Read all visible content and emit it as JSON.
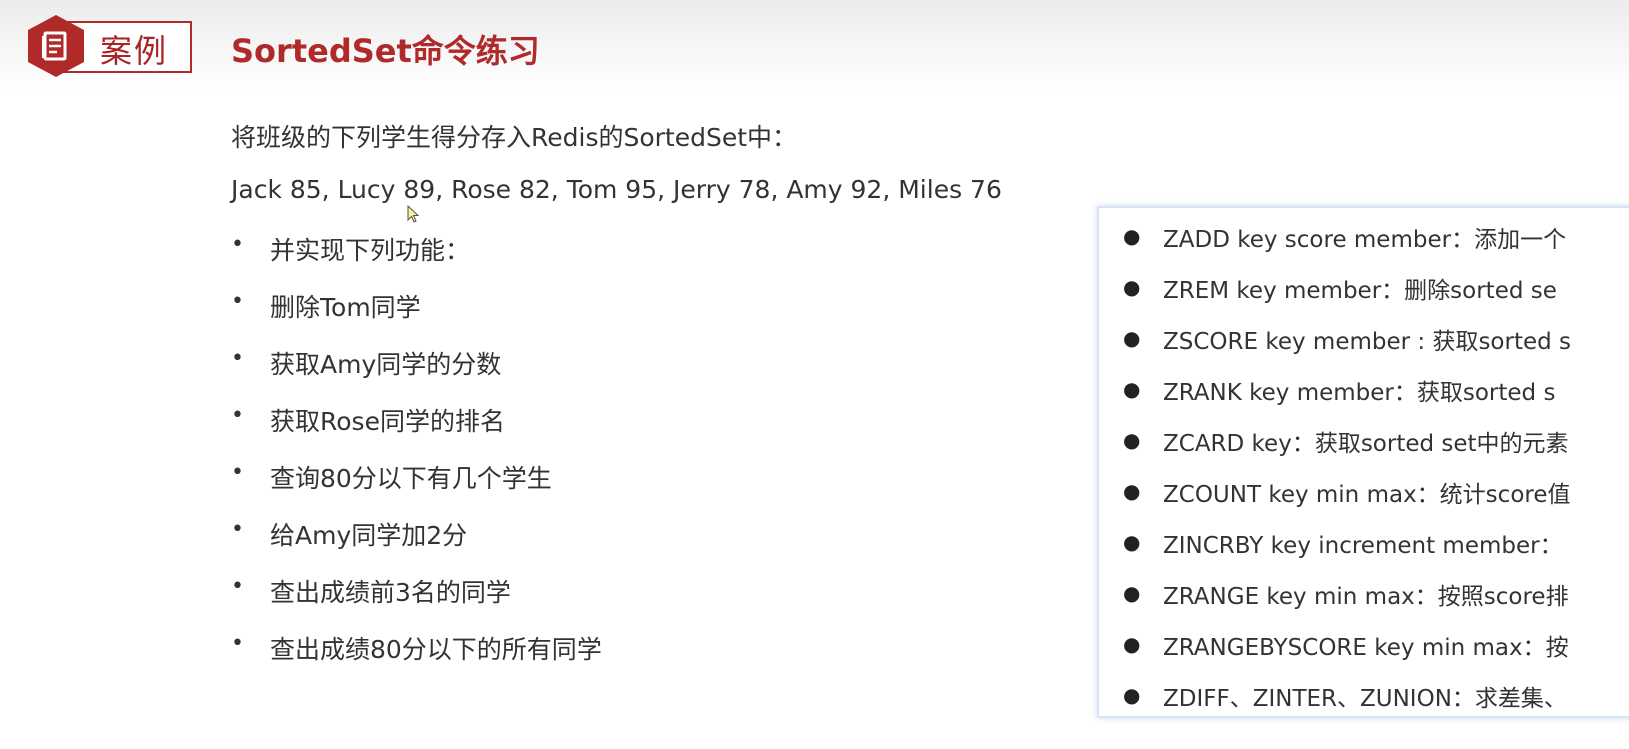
{
  "badge": {
    "label": "案例",
    "icon": "document-icon",
    "color": "#b02a2a"
  },
  "page": {
    "title": "SortedSet命令练习",
    "intro": "将班级的下列学生得分存入Redis的SortedSet中：",
    "scores": "Jack 85, Lucy 89, Rose 82, Tom 95, Jerry 78, Amy 92, Miles 76"
  },
  "tasks": [
    "并实现下列功能：",
    "删除Tom同学",
    "获取Amy同学的分数",
    "获取Rose同学的排名",
    "查询80分以下有几个学生",
    "给Amy同学加2分",
    "查出成绩前3名的同学",
    "查出成绩80分以下的所有同学"
  ],
  "commands": [
    "ZADD key score member：添加一个",
    "ZREM key member：删除sorted se",
    "ZSCORE key member : 获取sorted s",
    "ZRANK key member：获取sorted s",
    "ZCARD key：获取sorted set中的元素",
    "ZCOUNT key min max：统计score值",
    "ZINCRBY key increment member：",
    "ZRANGE key min max：按照score排",
    "ZRANGEBYSCORE key min max：按",
    "ZDIFF、ZINTER、ZUNION：求差集、"
  ]
}
